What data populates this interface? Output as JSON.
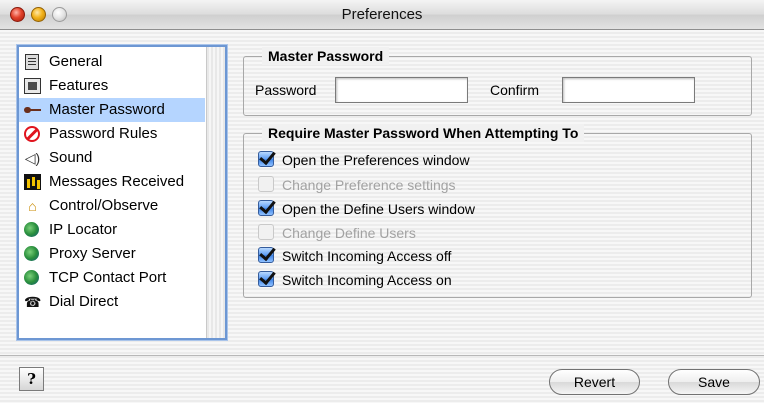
{
  "window": {
    "title": "Preferences"
  },
  "sidebar": {
    "items": [
      {
        "label": "General",
        "icon": "document-icon",
        "selected": false
      },
      {
        "label": "Features",
        "icon": "features-icon",
        "selected": false
      },
      {
        "label": "Master Password",
        "icon": "key-icon",
        "selected": true
      },
      {
        "label": "Password Rules",
        "icon": "prohibited-icon",
        "selected": false
      },
      {
        "label": "Sound",
        "icon": "speaker-icon",
        "selected": false
      },
      {
        "label": "Messages Received",
        "icon": "messages-icon",
        "selected": false
      },
      {
        "label": "Control/Observe",
        "icon": "control-icon",
        "selected": false
      },
      {
        "label": "IP Locator",
        "icon": "globe-icon",
        "selected": false
      },
      {
        "label": "Proxy Server",
        "icon": "globe-icon",
        "selected": false
      },
      {
        "label": "TCP Contact Port",
        "icon": "globe-icon",
        "selected": false
      },
      {
        "label": "Dial Direct",
        "icon": "telephone-icon",
        "selected": false
      }
    ]
  },
  "master_password": {
    "title": "Master Password",
    "password_label": "Password",
    "password_value": "",
    "confirm_label": "Confirm",
    "confirm_value": ""
  },
  "require": {
    "title": "Require Master Password When Attempting To",
    "options": [
      {
        "label": "Open the Preferences window",
        "checked": true,
        "enabled": true
      },
      {
        "label": "Change Preference settings",
        "checked": false,
        "enabled": false
      },
      {
        "label": "Open the Define Users window",
        "checked": true,
        "enabled": true
      },
      {
        "label": "Change Define Users",
        "checked": false,
        "enabled": false
      },
      {
        "label": "Switch Incoming Access off",
        "checked": true,
        "enabled": true
      },
      {
        "label": "Switch Incoming Access on",
        "checked": true,
        "enabled": true
      }
    ]
  },
  "footer": {
    "help_label": "?",
    "revert_label": "Revert",
    "save_label": "Save"
  },
  "colors": {
    "selection": "#b5d5ff",
    "list_border": "#6d97d3",
    "checkbox_on": "#3d82e6",
    "disabled_text": "#a2a2a2"
  }
}
